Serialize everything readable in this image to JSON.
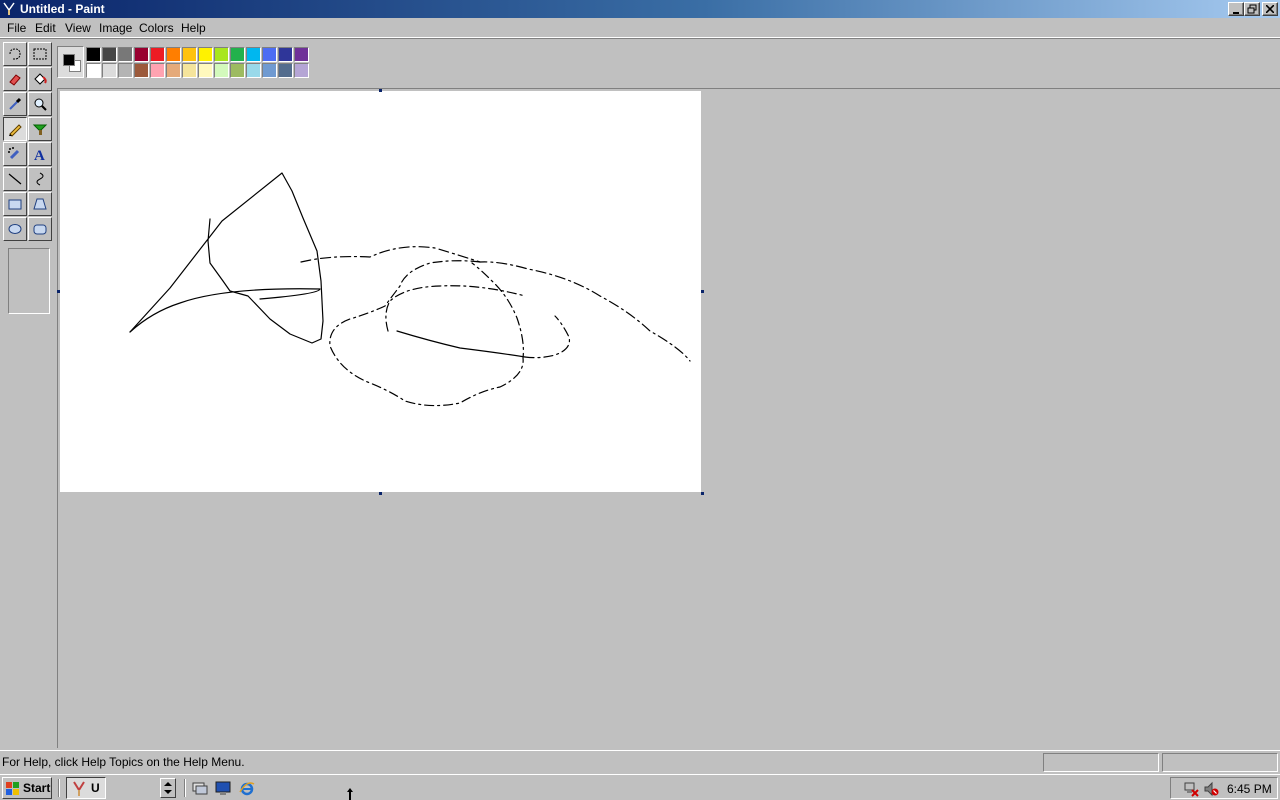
{
  "window": {
    "title": "Untitled - Paint",
    "minimize_icon": "minimize-icon",
    "restore_icon": "restore-icon",
    "close_icon": "close-icon"
  },
  "menu": [
    "File",
    "Edit",
    "View",
    "Image",
    "Colors",
    "Help"
  ],
  "tools": [
    {
      "name": "free-form-select",
      "icon": "free-form-select-icon"
    },
    {
      "name": "select",
      "icon": "rect-select-icon"
    },
    {
      "name": "eraser",
      "icon": "eraser-icon"
    },
    {
      "name": "fill-with-color",
      "icon": "fill-bucket-icon"
    },
    {
      "name": "pick-color",
      "icon": "eyedropper-icon"
    },
    {
      "name": "magnifier",
      "icon": "magnifier-icon"
    },
    {
      "name": "pencil",
      "icon": "pencil-icon",
      "selected": true
    },
    {
      "name": "brush",
      "icon": "brush-icon"
    },
    {
      "name": "airbrush",
      "icon": "airbrush-icon"
    },
    {
      "name": "text",
      "icon": "text-icon"
    },
    {
      "name": "line",
      "icon": "line-icon"
    },
    {
      "name": "curve",
      "icon": "curve-icon"
    },
    {
      "name": "rectangle",
      "icon": "rectangle-icon"
    },
    {
      "name": "polygon",
      "icon": "polygon-icon"
    },
    {
      "name": "ellipse",
      "icon": "ellipse-icon"
    },
    {
      "name": "rounded-rectangle",
      "icon": "rounded-rectangle-icon"
    }
  ],
  "palette": {
    "foreground": "#000000",
    "background": "#ffffff",
    "row1": [
      "#000000",
      "#464646",
      "#787878",
      "#990030",
      "#ed1c24",
      "#ff7e00",
      "#ffc20e",
      "#fff200",
      "#a8e61d",
      "#22b14c",
      "#00b7ef",
      "#4d6df3",
      "#2f3699",
      "#6f3198"
    ],
    "row2": [
      "#ffffff",
      "#dcdcdc",
      "#b4b4b4",
      "#9c5a3c",
      "#ffa3b1",
      "#e5aa7a",
      "#f5e49c",
      "#fff9bd",
      "#d3f9bc",
      "#9dbb61",
      "#99d9ea",
      "#709ad1",
      "#546d8e",
      "#b5a5d5"
    ]
  },
  "status": {
    "help_text": "For Help, click Help Topics on the Help Menu."
  },
  "taskbar": {
    "start_label": "Start",
    "task_label": "U",
    "clock": "6:45 PM"
  }
}
